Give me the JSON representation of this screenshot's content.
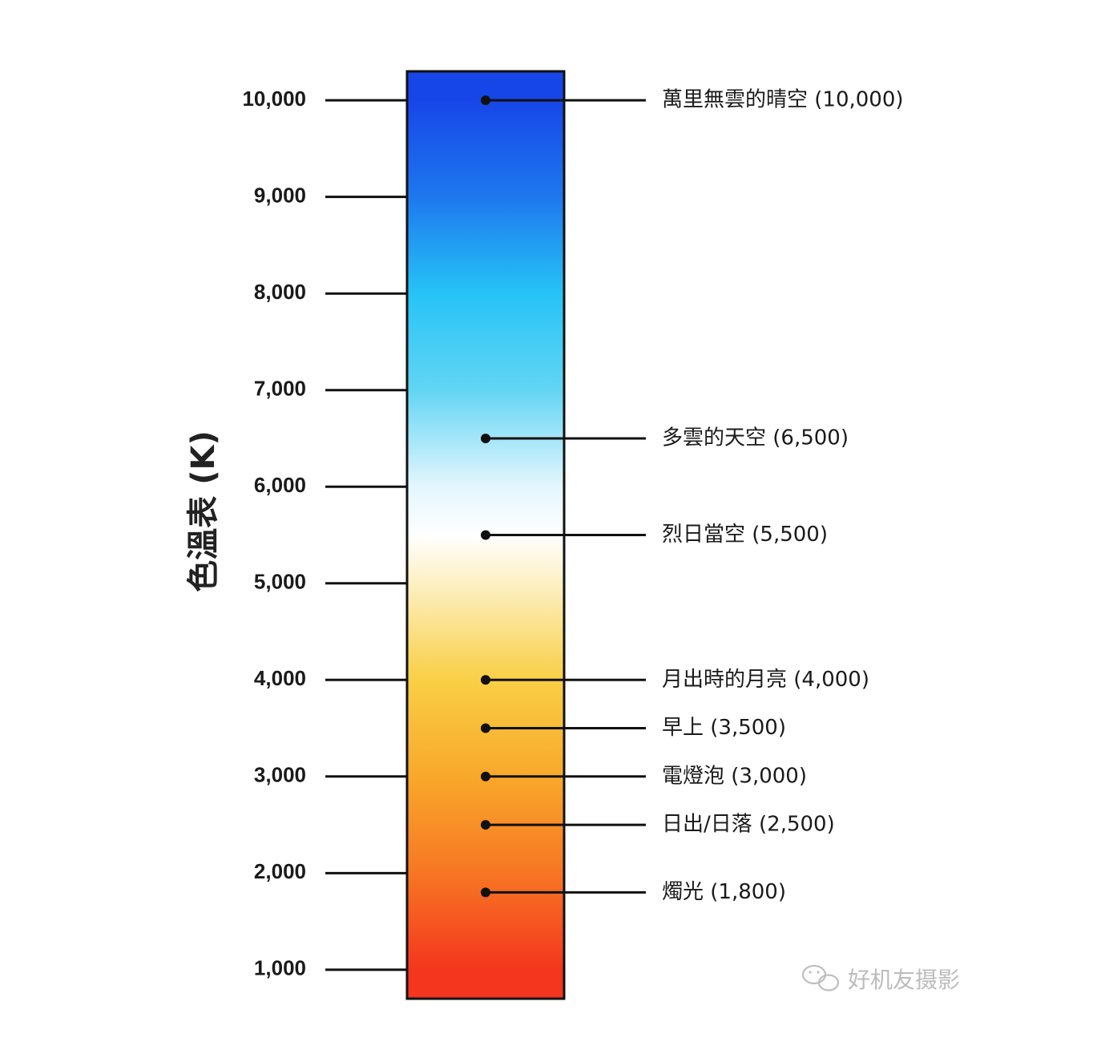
{
  "title": "色溫表 (K)",
  "watermark": "好机友摄影",
  "watermark_icon": "wechat-icon",
  "colors": {
    "bar_stops": [
      {
        "value": 10000,
        "color": "#1746e8"
      },
      {
        "value": 9000,
        "color": "#1e78ee"
      },
      {
        "value": 8000,
        "color": "#26c3f6"
      },
      {
        "value": 7000,
        "color": "#63d5f4"
      },
      {
        "value": 6000,
        "color": "#e4f6fd"
      },
      {
        "value": 5500,
        "color": "#ffffff"
      },
      {
        "value": 5000,
        "color": "#fdf0c4"
      },
      {
        "value": 4000,
        "color": "#f9cf45"
      },
      {
        "value": 3000,
        "color": "#f8a82a"
      },
      {
        "value": 2000,
        "color": "#f77624"
      },
      {
        "value": 1000,
        "color": "#f4361e"
      }
    ],
    "line": "#111111",
    "border": "#111111"
  },
  "chart_data": {
    "type": "scale",
    "ylim": [
      700,
      10300
    ],
    "ticks": [
      {
        "value": 10000,
        "label": "10,000"
      },
      {
        "value": 9000,
        "label": "9,000"
      },
      {
        "value": 8000,
        "label": "8,000"
      },
      {
        "value": 7000,
        "label": "7,000"
      },
      {
        "value": 6000,
        "label": "6,000"
      },
      {
        "value": 5000,
        "label": "5,000"
      },
      {
        "value": 4000,
        "label": "4,000"
      },
      {
        "value": 3000,
        "label": "3,000"
      },
      {
        "value": 2000,
        "label": "2,000"
      },
      {
        "value": 1000,
        "label": "1,000"
      }
    ],
    "markers": [
      {
        "value": 10000,
        "label": "萬里無雲的晴空 (10,000)"
      },
      {
        "value": 6500,
        "label": "多雲的天空 (6,500)"
      },
      {
        "value": 5500,
        "label": "烈日當空 (5,500)"
      },
      {
        "value": 4000,
        "label": "月出時的月亮 (4,000)"
      },
      {
        "value": 3500,
        "label": "早上 (3,500)"
      },
      {
        "value": 3000,
        "label": "電燈泡 (3,000)"
      },
      {
        "value": 2500,
        "label": "日出/日落 (2,500)"
      },
      {
        "value": 1800,
        "label": "燭光 (1,800)"
      }
    ]
  }
}
